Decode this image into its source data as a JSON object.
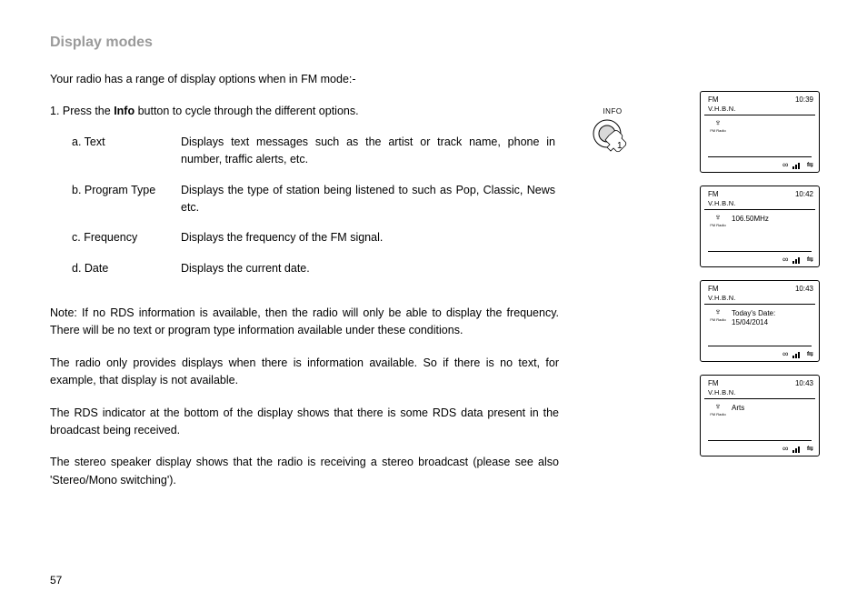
{
  "title": "Display modes",
  "intro": "Your radio has a range of display options when in FM mode:-",
  "step1_prefix": "1. Press the ",
  "step1_bold": "Info",
  "step1_suffix": " button to cycle through the different options.",
  "items": [
    {
      "label": "a. Text",
      "desc": "Displays text messages such as the artist or track name, phone in number, traffic alerts, etc."
    },
    {
      "label": "b. Program Type",
      "desc": "Displays the type of station being listened to such as Pop, Classic, News etc."
    },
    {
      "label": "c. Frequency",
      "desc": "Displays the frequency of the FM signal."
    },
    {
      "label": "d. Date",
      "desc": "Displays the current date."
    }
  ],
  "note": "Note: If no RDS information is available, then the radio will only be able to display the frequency. There will be no text or program type information available under these conditions.",
  "para2": "The radio only provides displays when there is information available. So if there is no text, for example, that display is not available.",
  "para3": "The RDS indicator at the bottom of the display shows that there is some RDS data present in the broadcast being received.",
  "para4": "The stereo speaker display shows that the radio is receiving a stereo broadcast (please see also 'Stereo/Mono switching').",
  "page_num": "57",
  "info_label": "INFO",
  "info_step": "1",
  "fm_icon_label": "FM Radio",
  "icon_glyph": "♆",
  "inf_glyph": "∞",
  "wave_glyph": "⇋",
  "panels": [
    {
      "mode": "FM",
      "time": "10:39",
      "station": "V.H.B.N.",
      "mid": ""
    },
    {
      "mode": "FM",
      "time": "10:42",
      "station": "V.H.B.N.",
      "mid": "106.50MHz"
    },
    {
      "mode": "FM",
      "time": "10:43",
      "station": "V.H.B.N.",
      "mid": "Today's Date:\n15/04/2014"
    },
    {
      "mode": "FM",
      "time": "10:43",
      "station": "V.H.B.N.",
      "mid": "Arts"
    }
  ]
}
